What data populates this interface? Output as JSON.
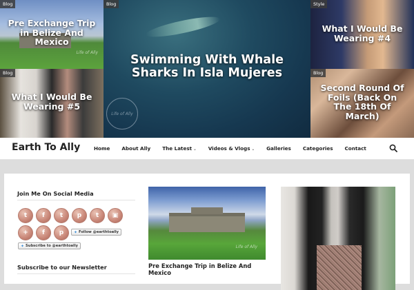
{
  "hero": {
    "tiles": [
      {
        "tag": "Blog",
        "title": "Pre Exchange Trip in Belize And Mexico",
        "watermark": "Life of Ally"
      },
      {
        "tag": "Blog",
        "title": "Swimming With Whale Sharks In Isla Mujeres",
        "stamp": "Life of Ally"
      },
      {
        "tag": "Style",
        "title": "What I Would Be Wearing #4"
      },
      {
        "tag": "Blog",
        "title": "What I Would Be Wearing #5"
      },
      {
        "tag": "Blog",
        "title": "Second Round Of Foils (Back On The 18th Of March)"
      }
    ]
  },
  "nav": {
    "brand": "Earth To Ally",
    "items": [
      {
        "label": "Home"
      },
      {
        "label": "About Ally"
      },
      {
        "label": "The Latest",
        "dropdown": true
      },
      {
        "label": "Videos & Vlogs",
        "dropdown": true
      },
      {
        "label": "Galleries"
      },
      {
        "label": "Categories"
      },
      {
        "label": "Contact"
      }
    ],
    "search_icon": "search-icon"
  },
  "sidebar": {
    "social_title": "Join Me On Social Media",
    "follow_label": "Follow @earthtoally",
    "subscribe_label": "Subscribe to @earthtoally",
    "newsletter_title": "Subscribe to our Newsletter",
    "social_icons": [
      "twitter-icon",
      "facebook-icon",
      "twitter-icon",
      "pinterest-icon",
      "tumblr-icon",
      "instagram-icon",
      "plus-icon",
      "facebook-icon",
      "pinterest-icon"
    ]
  },
  "posts": [
    {
      "title": "Pre Exchange Trip in Belize And Mexico",
      "watermark": "Life of Ally"
    }
  ],
  "colors": {
    "nav_bg": "#ffffff",
    "page_bg": "#dddddd",
    "text": "#222222",
    "social_icon": "#c98778"
  }
}
